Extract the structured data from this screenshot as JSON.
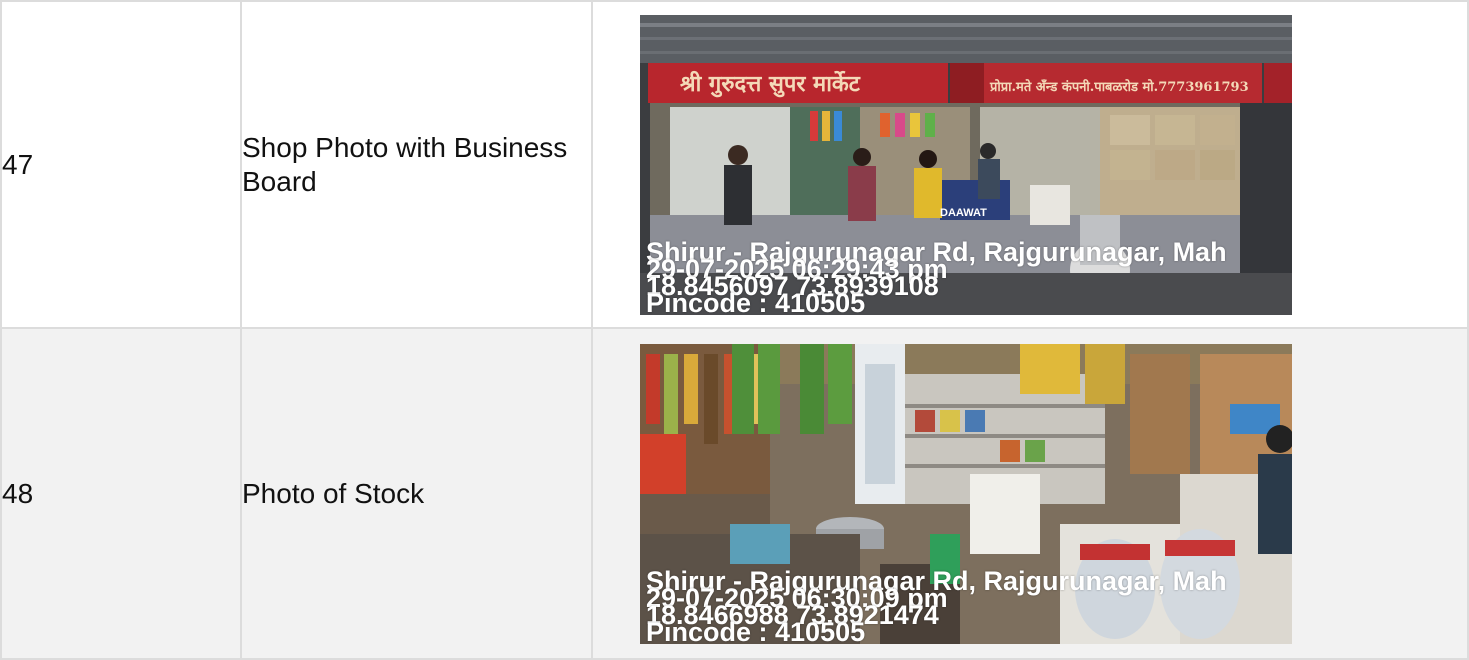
{
  "rows": [
    {
      "number": "47",
      "label": "Shop Photo with Business Board",
      "photo": {
        "subject": "shop-front",
        "sign_text_left": "श्री गुरुदत्त सुपर मार्केट",
        "sign_text_right": "प्रोप्रा.मते अँन्ड कंपनी.पाबळरोड मो.7773961793",
        "banner_text": "DAAWAT",
        "overlay": {
          "location": "Shirur - Rajgurunagar Rd, Rajgurunagar, Mah",
          "timestamp": "29-07-2025 06:29:43 pm",
          "coordinates": "18.8456097 73.8939108",
          "pincode": "Pincode : 410505"
        }
      }
    },
    {
      "number": "48",
      "label": "Photo of Stock",
      "photo": {
        "subject": "shop-interior-stock",
        "overlay": {
          "location": "Shirur - Rajgurunagar Rd, Rajgurunagar, Mah",
          "timestamp": "29-07-2025 06:30:09 pm",
          "coordinates": "18.8466988 73.8921474",
          "pincode": "Pincode : 410505"
        }
      }
    }
  ]
}
